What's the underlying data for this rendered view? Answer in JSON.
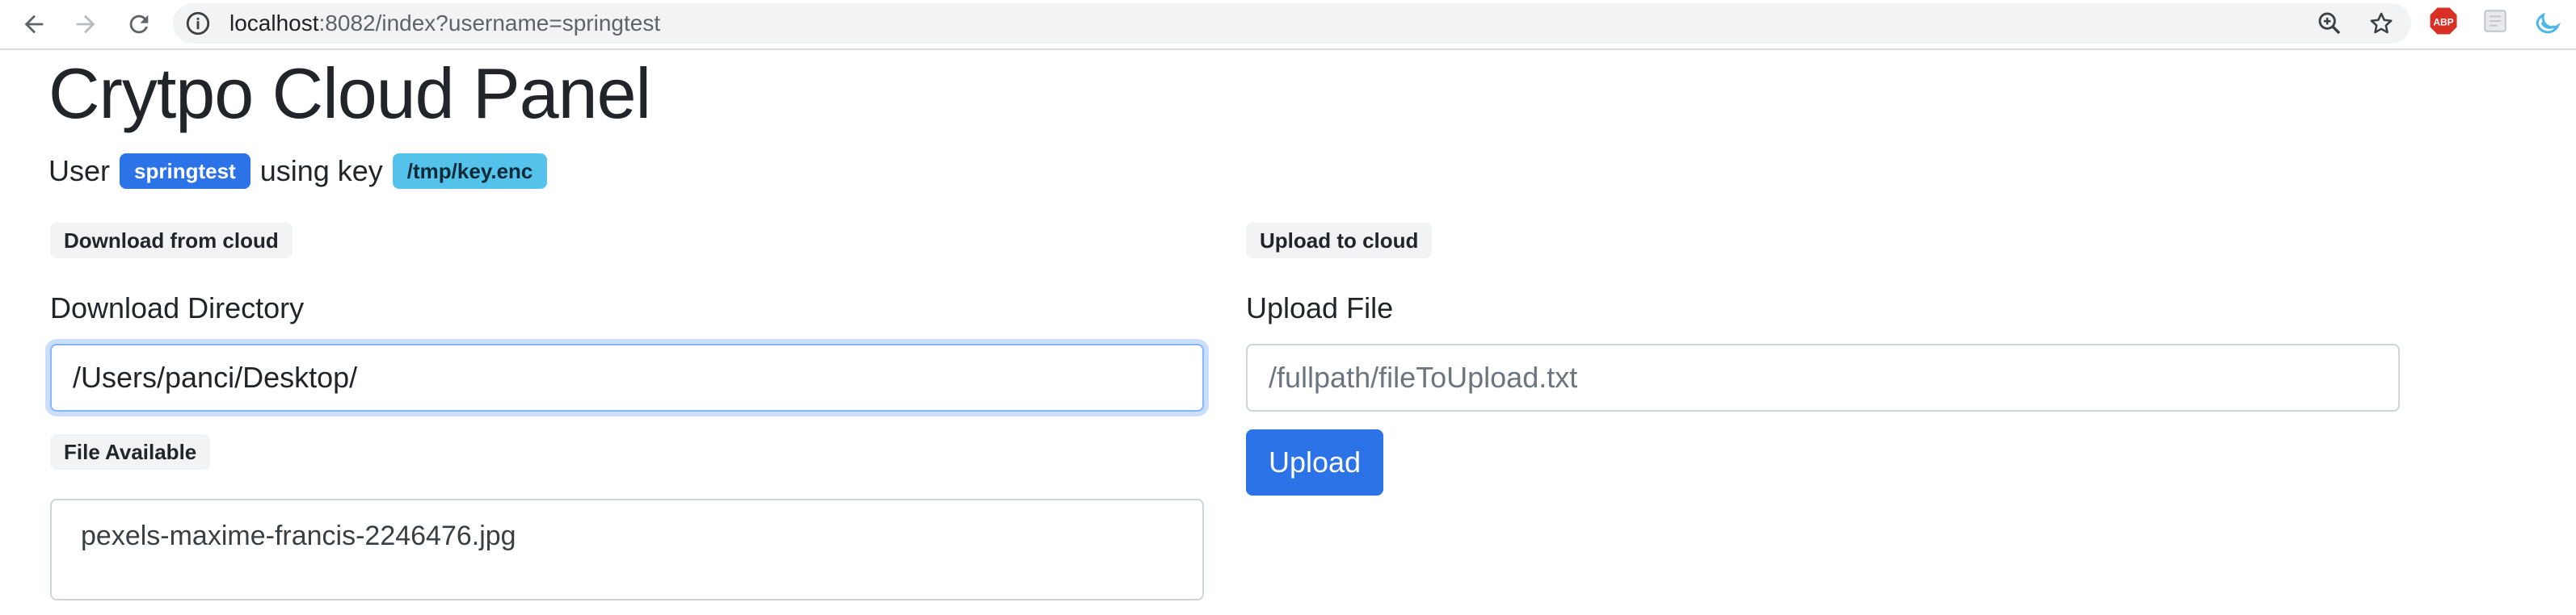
{
  "browser": {
    "url_host": "localhost",
    "url_rest": ":8082/index?username=springtest",
    "icons": [
      "back-arrow-icon",
      "forward-arrow-icon",
      "reload-icon",
      "site-info-icon",
      "zoom-icon",
      "bookmark-star-icon",
      "adblock-extension-icon",
      "extension-icon",
      "extension-moon-icon"
    ],
    "adblock_label": "ABP"
  },
  "header": {
    "title": "Crytpo Cloud Panel",
    "user_prefix": "User",
    "username": "springtest",
    "key_prefix": "using key",
    "key_path": "/tmp/key.enc"
  },
  "download": {
    "section_label": "Download from cloud",
    "dir_label": "Download Directory",
    "dir_value": "/Users/panci/Desktop/",
    "files_label": "File Available",
    "files": [
      "pexels-maxime-francis-2246476.jpg"
    ]
  },
  "upload": {
    "section_label": "Upload to cloud",
    "file_label": "Upload File",
    "file_placeholder": "/fullpath/fileToUpload.txt",
    "file_value": "",
    "button_label": "Upload"
  },
  "colors": {
    "primary": "#2d73e8",
    "info": "#54c2ea",
    "adblock_red": "#d93025"
  }
}
